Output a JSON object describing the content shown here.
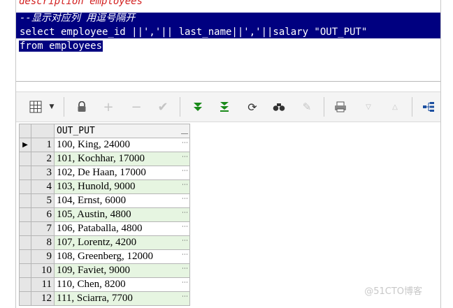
{
  "editor": {
    "cut_line": "description employees",
    "comment_line": "--显示对应列 用逗号隔开",
    "select_line": "select employee_id ||','|| last_name||','||salary \"OUT_PUT\"",
    "from_line": "from employees"
  },
  "toolbar": {
    "icons": [
      "grid-icon",
      "dropdown-arrow-icon",
      "lock-icon",
      "add-icon",
      "remove-icon",
      "check-icon",
      "fetch-next-icon",
      "fetch-all-icon",
      "refresh-icon",
      "find-icon",
      "clear-icon",
      "print-icon",
      "down-icon",
      "up-icon",
      "tree-icon"
    ]
  },
  "grid": {
    "column": "OUT_PUT",
    "rows": [
      {
        "n": "1",
        "value": "100, King, 24000"
      },
      {
        "n": "2",
        "value": "101, Kochhar, 17000"
      },
      {
        "n": "3",
        "value": "102, De Haan, 17000"
      },
      {
        "n": "4",
        "value": "103, Hunold, 9000"
      },
      {
        "n": "5",
        "value": "104, Ernst, 6000"
      },
      {
        "n": "6",
        "value": "105, Austin, 4800"
      },
      {
        "n": "7",
        "value": "106, Pataballa, 4800"
      },
      {
        "n": "8",
        "value": "107, Lorentz, 4200"
      },
      {
        "n": "9",
        "value": "108, Greenberg, 12000"
      },
      {
        "n": "10",
        "value": "109, Faviet, 9000"
      },
      {
        "n": "11",
        "value": "110, Chen, 8200"
      },
      {
        "n": "12",
        "value": "111, Sciarra, 7700"
      }
    ]
  },
  "watermark": "@51CTO博客",
  "colors": {
    "selection": "#000080",
    "alt_row": "#e6f5e1",
    "cut_text": "#d21e1e"
  }
}
